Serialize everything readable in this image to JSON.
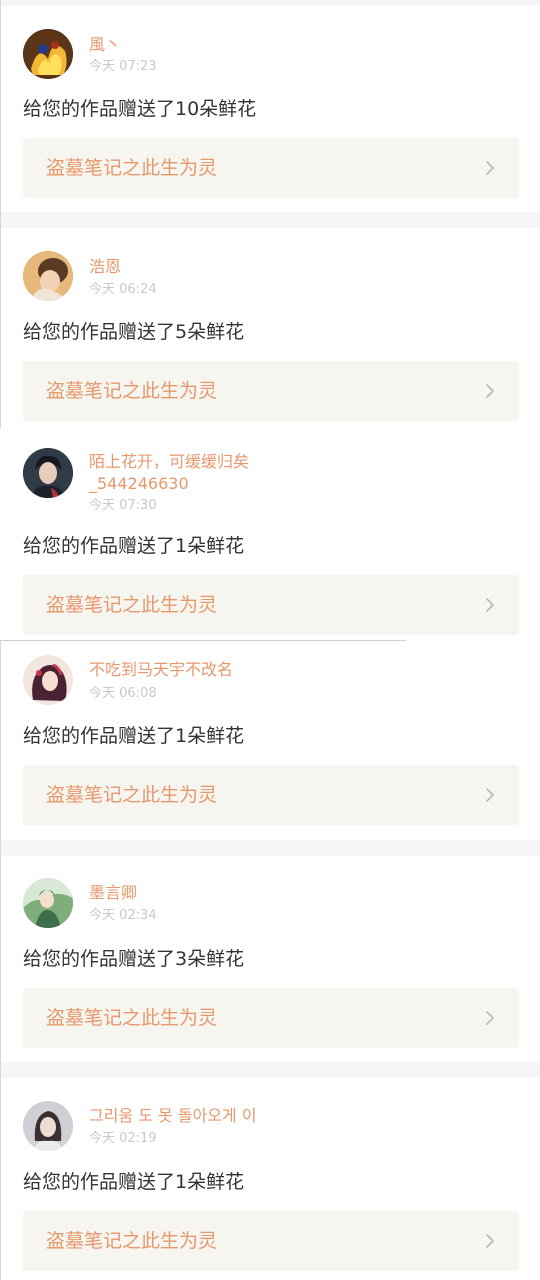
{
  "notifications": [
    {
      "username": "風丶",
      "time": "今天 07:23",
      "message": "给您的作品赠送了10朵鲜花",
      "work_title": "盗墓笔记之此生为灵",
      "avatar_icon": "user-avatar-fire-character"
    },
    {
      "username": "浩恩",
      "time": "今天 06:24",
      "message": "给您的作品赠送了5朵鲜花",
      "work_title": "盗墓笔记之此生为灵",
      "avatar_icon": "user-avatar-girl-photo"
    },
    {
      "username_line1": "陌上花开，可缓缓归矣",
      "username_line2": "_544246630",
      "time": "今天 07:30",
      "message": "给您的作品赠送了1朵鲜花",
      "work_title": "盗墓笔记之此生为灵",
      "avatar_icon": "user-avatar-boy-photo"
    },
    {
      "username": "不吃到马天宇不改名",
      "time": "今天 06:08",
      "message": "给您的作品赠送了1朵鲜花",
      "work_title": "盗墓笔记之此生为灵",
      "avatar_icon": "user-avatar-anime-girl"
    },
    {
      "username": "墨言卿",
      "time": "今天 02:34",
      "message": "给您的作品赠送了3朵鲜花",
      "work_title": "盗墓笔记之此生为灵",
      "avatar_icon": "user-avatar-green-illustration"
    },
    {
      "username": "그리움 도 못 돌아오게 이",
      "time": "今天 02:19",
      "message": "给您的作品赠送了1朵鲜花",
      "work_title": "盗墓笔记之此生为灵",
      "avatar_icon": "user-avatar-portrait"
    }
  ],
  "colors": {
    "username": "#e7986c",
    "timestamp": "#c9c9c9",
    "message": "#333333",
    "link_background": "#f6f5ef",
    "separator": "#f6f6f6"
  },
  "icons": {
    "chevron": "chevron-right-icon"
  }
}
